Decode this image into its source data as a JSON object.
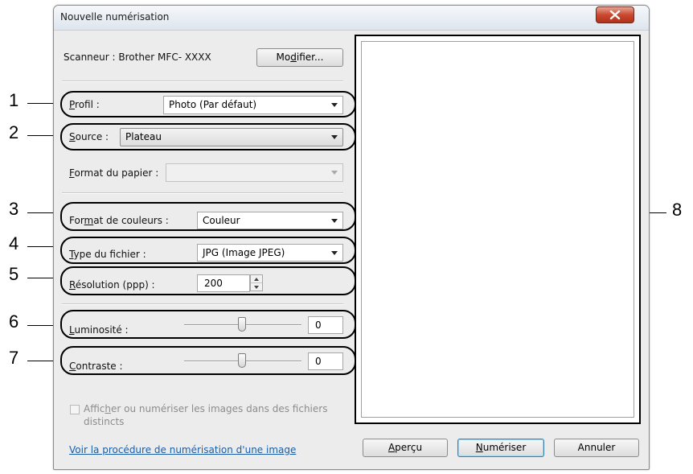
{
  "window": {
    "title": "Nouvelle numérisation"
  },
  "scanner": {
    "label": "Scanneur : Brother MFC- XXXX",
    "modify_button": {
      "pre": "Mo",
      "u": "d",
      "post": "ifier..."
    }
  },
  "profile": {
    "label_u": "P",
    "label_rest": "rofil :",
    "value": "Photo (Par défaut)"
  },
  "source": {
    "label_u": "S",
    "label_rest": "ource :",
    "value": "Plateau"
  },
  "paper_format": {
    "label_u": "F",
    "label_rest": "ormat du papier :",
    "value": ""
  },
  "color_format": {
    "label_pre": "For",
    "label_u": "m",
    "label_post": "at de couleurs :",
    "value": "Couleur"
  },
  "file_type": {
    "label_u": "T",
    "label_rest": "ype du fichier :",
    "value": "JPG (Image JPEG)"
  },
  "resolution": {
    "label_u": "R",
    "label_rest": "ésolution (ppp) :",
    "value": "200"
  },
  "brightness": {
    "label_u": "L",
    "label_rest": "uminosité :",
    "value": "0",
    "level": 0.5
  },
  "contrast": {
    "label_u": "C",
    "label_rest": "ontraste :",
    "value": "0",
    "level": 0.5
  },
  "separate_files": {
    "line1_pre": "Affic",
    "line1_u": "h",
    "line1_post": "er ou numériser les images dans des fichiers",
    "line2": "distincts",
    "checked": false
  },
  "help_link": "Voir la procédure de numérisation d'une image",
  "buttons": {
    "preview": {
      "u": "A",
      "rest": "perçu"
    },
    "scan": {
      "u": "N",
      "rest": "umériser"
    },
    "cancel": "Annuler"
  },
  "callouts": [
    "1",
    "2",
    "3",
    "4",
    "5",
    "6",
    "7",
    "8"
  ],
  "colors": {
    "link": "#1a5ea8",
    "close": "#c9482f",
    "dialog_bg": "#ececec"
  },
  "icons": {
    "close": "close-x-icon",
    "dropdown": "chevron-down-icon",
    "spinner": "spin-arrows-icon"
  }
}
